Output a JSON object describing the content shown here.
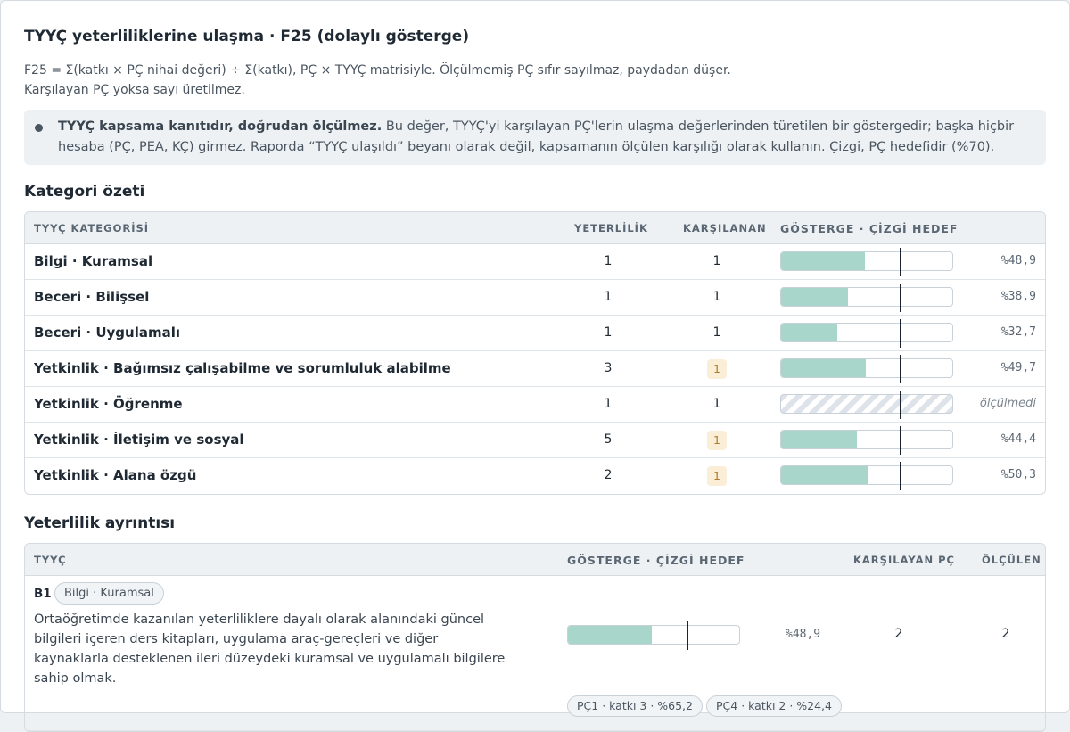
{
  "header": {
    "title": "TYYÇ yeterliliklerine ulaşma · F25 (dolaylı gösterge)",
    "desc_line1": "F25 = Σ(katkı × PÇ nihai değeri) ÷ Σ(katkı), PÇ × TYYÇ matrisiyle. Ölçülmemiş PÇ sıfır sayılmaz, paydadan düşer.",
    "desc_line2": "Karşılayan PÇ yoksa sayı üretilmez."
  },
  "note": {
    "bold": "TYYÇ kapsama kanıtıdır, doğrudan ölçülmez.",
    "text": " Bu değer, TYYÇ'yi karşılayan PÇ'lerin ulaşma değerlerinden türetilen bir göstergedir; başka hiçbir hesaba (PÇ, PEA, KÇ) girmez. Raporda “TYYÇ ulaşıldı” beyanı olarak değil, kapsamanın ölçülen karşılığı olarak kullanın. Çizgi, PÇ hedefidir (%70)."
  },
  "target_percent": 70,
  "summary": {
    "title": "Kategori özeti",
    "headers": {
      "category": "TYYÇ KATEGORİSİ",
      "count": "YETERLİLİK",
      "met": "KARŞILANAN",
      "indicator": "GÖSTERGE · ÇİZGİ HEDEF"
    },
    "rows": [
      {
        "name": "Bilgi · Kuramsal",
        "count": "1",
        "met": "1",
        "met_flag": false,
        "value": 48.9,
        "label": "%48,9"
      },
      {
        "name": "Beceri · Bilişsel",
        "count": "1",
        "met": "1",
        "met_flag": false,
        "value": 38.9,
        "label": "%38,9"
      },
      {
        "name": "Beceri · Uygulamalı",
        "count": "1",
        "met": "1",
        "met_flag": false,
        "value": 32.7,
        "label": "%32,7"
      },
      {
        "name": "Yetkinlik · Bağımsız çalışabilme ve sorumluluk alabilme",
        "count": "3",
        "met": "1",
        "met_flag": true,
        "value": 49.7,
        "label": "%49,7"
      },
      {
        "name": "Yetkinlik · Öğrenme",
        "count": "1",
        "met": "1",
        "met_flag": false,
        "value": null,
        "label": "ölçülmedi"
      },
      {
        "name": "Yetkinlik · İletişim ve sosyal",
        "count": "5",
        "met": "1",
        "met_flag": true,
        "value": 44.4,
        "label": "%44,4"
      },
      {
        "name": "Yetkinlik · Alana özgü",
        "count": "2",
        "met": "1",
        "met_flag": true,
        "value": 50.3,
        "label": "%50,3"
      }
    ]
  },
  "detail": {
    "title": "Yeterlilik ayrıntısı",
    "headers": {
      "tyyc": "TYYÇ",
      "indicator": "GÖSTERGE · ÇİZGİ HEDEF",
      "met_pc": "KARŞILAYAN PÇ",
      "measured": "ÖLÇÜLEN"
    },
    "rows": [
      {
        "code": "B1",
        "category": "Bilgi · Kuramsal",
        "text": "Ortaöğretimde kazanılan yeterliliklere dayalı olarak alanındaki güncel bilgileri içeren ders kitapları, uygulama araç-gereçleri ve diğer kaynaklarla desteklenen ileri düzeydeki kuramsal ve uygulamalı bilgilere sahip olmak.",
        "value": 48.9,
        "label": "%48,9",
        "met_pc": "2",
        "measured": "2",
        "pc_chips": [
          "PÇ1 · katkı 3 · %65,2",
          "PÇ4 · katkı 2 · %24,4"
        ]
      }
    ]
  }
}
